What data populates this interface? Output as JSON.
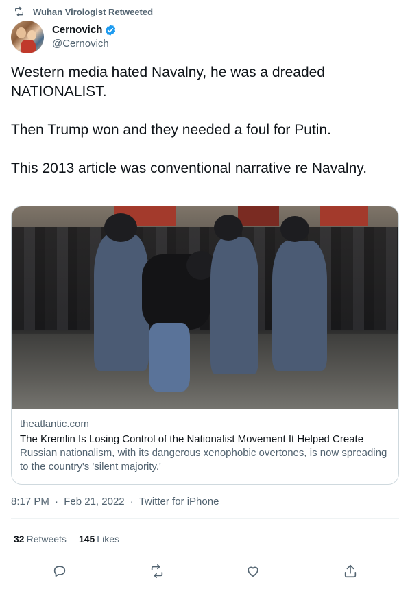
{
  "retweet_bar": {
    "text": "Wuhan Virologist Retweeted",
    "icon": "retweet-icon"
  },
  "author": {
    "display_name": "Cernovich",
    "handle": "@Cernovich",
    "verified": true,
    "verified_color": "#1d9bf0"
  },
  "tweet": {
    "paragraphs": [
      "Western media hated Navalny, he was a dreaded NATIONALIST.",
      "Then Trump won and they needed a foul for Putin.",
      "This 2013 article was conventional narrative re Navalny."
    ]
  },
  "card": {
    "domain": "theatlantic.com",
    "title": "The Kremlin Is Losing Control of the Nationalist Movement It Helped Create",
    "description": "Russian nationalism, with its dangerous xenophobic overtones, is now spreading to the country's 'silent majority.'"
  },
  "meta": {
    "time": "8:17 PM",
    "date": "Feb 21, 2022",
    "source": "Twitter for iPhone",
    "separator": "·"
  },
  "stats": {
    "retweets_count": "32",
    "retweets_label": "Retweets",
    "likes_count": "145",
    "likes_label": "Likes"
  },
  "actions": [
    "reply-icon",
    "retweet-icon",
    "like-icon",
    "share-icon"
  ],
  "colors": {
    "text": "#0f1419",
    "secondary": "#536471",
    "border": "#cfd9de",
    "accent": "#1d9bf0"
  }
}
